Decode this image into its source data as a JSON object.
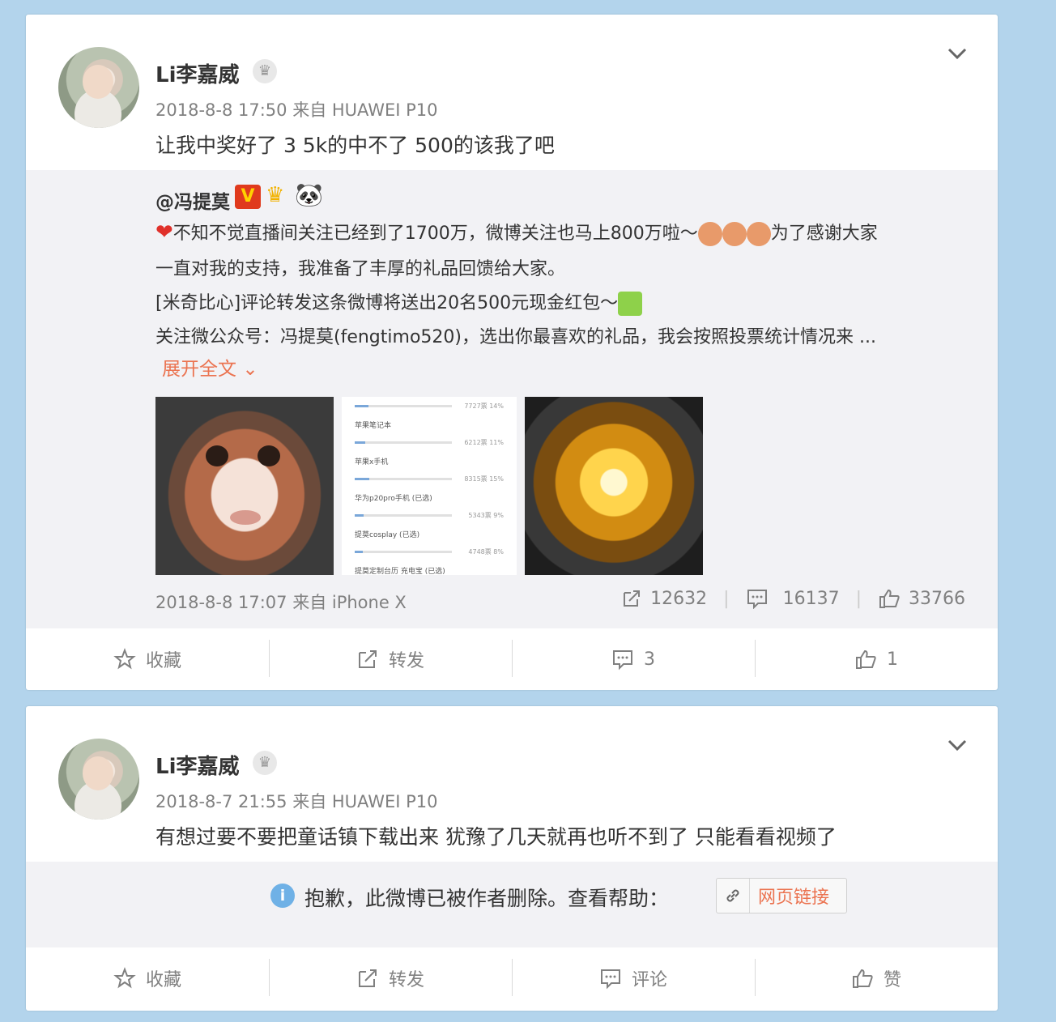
{
  "posts": [
    {
      "username": "Li李嘉威",
      "meta": "2018-8-8 17:50 来自 HUAWEI P10",
      "text": "让我中奖好了  3 5k的中不了 500的该我了吧",
      "repost": {
        "user": "@冯提莫",
        "line1_a": "不知不觉直播间关注已经到了1700万，微博关注也马上800万啦～",
        "line1_b": "为了感谢大家",
        "line2": "一直对我的支持，我准备了丰厚的礼品回馈给大家。",
        "line3": "[米奇比心]评论转发这条微博将送出20名500元现金红包～",
        "line4": "关注微公众号：冯提莫(fengtimo520)，选出你最喜欢的礼品，我会按照投票统计情况来 ...",
        "expand": "展开全文",
        "poll": [
          {
            "count": "7727票",
            "pct": "14%",
            "label": "苹果笔记本",
            "fill": 0.14
          },
          {
            "count": "6212票",
            "pct": "11%",
            "label": "苹果x手机",
            "fill": 0.11
          },
          {
            "count": "8315票",
            "pct": "15%",
            "label": "华为p20pro手机 (已选)",
            "fill": 0.15
          },
          {
            "count": "5343票",
            "pct": "9%",
            "label": "提莫cosplay (已选)",
            "fill": 0.09
          },
          {
            "count": "4748票",
            "pct": "8%",
            "label": "提莫定制台历 充电宝 (已选)",
            "fill": 0.08
          }
        ],
        "meta": "2018-8-8 17:07 来自 iPhone X",
        "reposts": "12632",
        "comments": "16137",
        "likes": "33766"
      },
      "actions": {
        "fav": "收藏",
        "repost": "转发",
        "comment": "3",
        "like": "1"
      }
    },
    {
      "username": "Li李嘉威",
      "meta": "2018-8-7 21:55 来自 HUAWEI P10",
      "text": "有想过要不要把童话镇下载出来 犹豫了几天就再也听不到了 只能看看视频了",
      "deleted_notice": "抱歉，此微博已被作者删除。查看帮助：",
      "web_link": "网页链接",
      "actions": {
        "fav": "收藏",
        "repost": "转发",
        "comment": "评论",
        "like": "赞"
      }
    }
  ],
  "colors": {
    "background": "#b3d4ec",
    "accent": "#eb7350",
    "muted": "#808080"
  },
  "icons": [
    "crown-icon",
    "chevron-down-icon",
    "star-icon",
    "repost-icon",
    "comment-icon",
    "thumb-up-icon",
    "info-icon",
    "link-icon"
  ]
}
